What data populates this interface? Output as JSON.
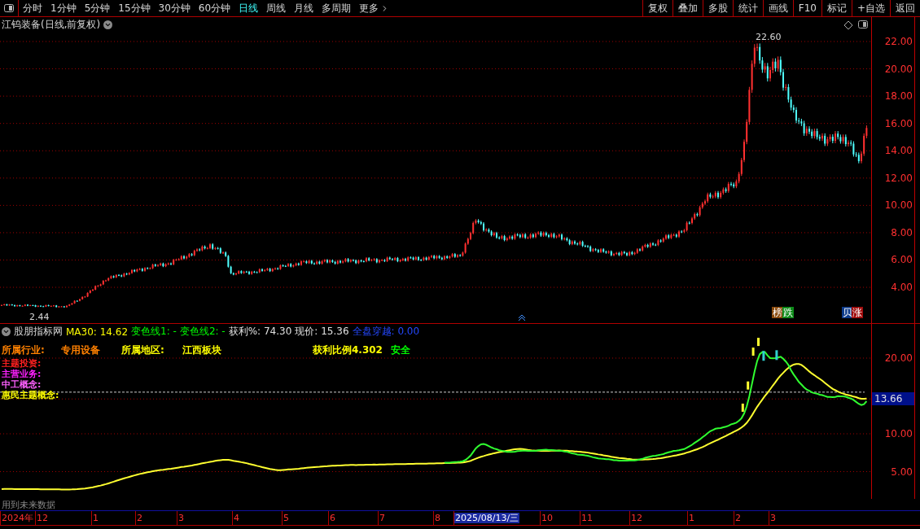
{
  "toolbar": {
    "periods": [
      {
        "label": "分时",
        "selected": false
      },
      {
        "label": "1分钟",
        "selected": false
      },
      {
        "label": "5分钟",
        "selected": false
      },
      {
        "label": "15分钟",
        "selected": false
      },
      {
        "label": "30分钟",
        "selected": false
      },
      {
        "label": "60分钟",
        "selected": false
      },
      {
        "label": "日线",
        "selected": true
      },
      {
        "label": "周线",
        "selected": false
      },
      {
        "label": "月线",
        "selected": false
      },
      {
        "label": "多周期",
        "selected": false
      },
      {
        "label": "更多",
        "selected": false
      }
    ],
    "buttons": [
      "复权",
      "叠加",
      "多股",
      "统计",
      "画线",
      "F10",
      "标记",
      "+自选",
      "返回"
    ]
  },
  "price_chart": {
    "title": "江钨装备(日线,前复权)",
    "high_label": "22.60",
    "low_label": "2.44",
    "y_labels": [
      "22.00",
      "20.00",
      "18.00",
      "16.00",
      "14.00",
      "12.00",
      "10.00",
      "8.00",
      "6.00",
      "4.00"
    ],
    "badges": [
      {
        "text": "榜",
        "color": "#8a4a0c"
      },
      {
        "text": "跌",
        "color": "#0c8a18"
      },
      {
        "text": "贝",
        "color": "#0c3a8a"
      },
      {
        "text": "涨",
        "color": "#a00c0c"
      }
    ]
  },
  "indicator": {
    "name": "股朋指标网",
    "values": [
      {
        "text": "MA30: 14.62",
        "color": "#ffff00"
      },
      {
        "text": "变色线1: -",
        "color": "#00ff00"
      },
      {
        "text": "变色线2: -",
        "color": "#00ff00"
      },
      {
        "text": "获利%: 74.30",
        "color": "#e0e0e0"
      },
      {
        "text": "现价: 15.36",
        "color": "#e0e0e0"
      },
      {
        "text": "全盘穿越: 0.00",
        "color": "#2448ff"
      }
    ],
    "info_row": [
      {
        "text": "所属行业:",
        "color": "#ff8000"
      },
      {
        "text": "专用设备",
        "color": "#ff8000"
      },
      {
        "text": "所属地区:",
        "color": "#ffff00"
      },
      {
        "text": "江西板块",
        "color": "#ffff00"
      },
      {
        "text": "获利比例4.302",
        "color": "#ffff00"
      },
      {
        "text": "安全",
        "color": "#00ff00"
      }
    ],
    "info_lines": [
      {
        "text": "主题投资:",
        "color": "#ff2020"
      },
      {
        "text": "主营业务:",
        "color": "#ff20ff"
      },
      {
        "text": "中工概念:",
        "color": "#ff60ff"
      },
      {
        "text": "惠民主题概念:",
        "color": "#ffff00"
      }
    ],
    "y_labels": [
      "20.00",
      "10.00",
      "5.00"
    ],
    "current_price": "13.66"
  },
  "footer_note": "用到未来数据",
  "date_axis": [
    {
      "label": "2024年",
      "selected": false
    },
    {
      "label": "12",
      "selected": false
    },
    {
      "label": "1",
      "selected": false
    },
    {
      "label": "2",
      "selected": false
    },
    {
      "label": "3",
      "selected": false
    },
    {
      "label": "4",
      "selected": false
    },
    {
      "label": "5",
      "selected": false
    },
    {
      "label": "6",
      "selected": false
    },
    {
      "label": "7",
      "selected": false
    },
    {
      "label": "8",
      "selected": false
    },
    {
      "label": "2025/08/13/三",
      "selected": true
    },
    {
      "label": "10",
      "selected": false
    },
    {
      "label": "11",
      "selected": false
    },
    {
      "label": "12",
      "selected": false
    },
    {
      "label": "1",
      "selected": false
    },
    {
      "label": "2",
      "selected": false
    },
    {
      "label": "3",
      "selected": false
    }
  ]
}
